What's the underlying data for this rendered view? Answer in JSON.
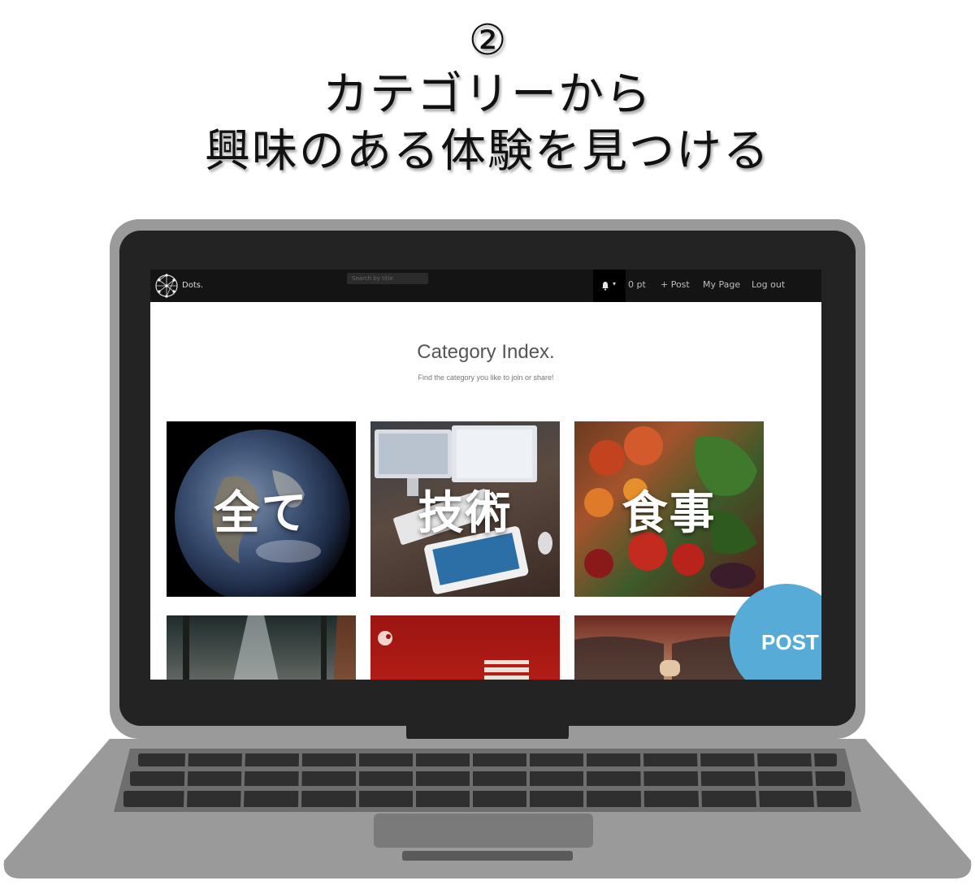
{
  "heading": {
    "step": "②",
    "line1": "カテゴリーから",
    "line2": "興味のある体験を見つける"
  },
  "navbar": {
    "brand": "Dots.",
    "search_placeholder": "Search by title",
    "points": "0 pt",
    "post": "+ Post",
    "my_page": "My Page",
    "logout": "Log out"
  },
  "page": {
    "title": "Category Index.",
    "subtitle": "Find the category you like to join or share!"
  },
  "categories": [
    {
      "label": "全て"
    },
    {
      "label": "技術"
    },
    {
      "label": "食事"
    },
    {
      "label": ""
    },
    {
      "label": ""
    },
    {
      "label": ""
    }
  ],
  "fab": {
    "label": "POST",
    "color": "#56acd7"
  },
  "colors": {
    "navbar": "#141414",
    "laptop_frame": "#9a9a9a",
    "laptop_bezel": "#232323"
  }
}
